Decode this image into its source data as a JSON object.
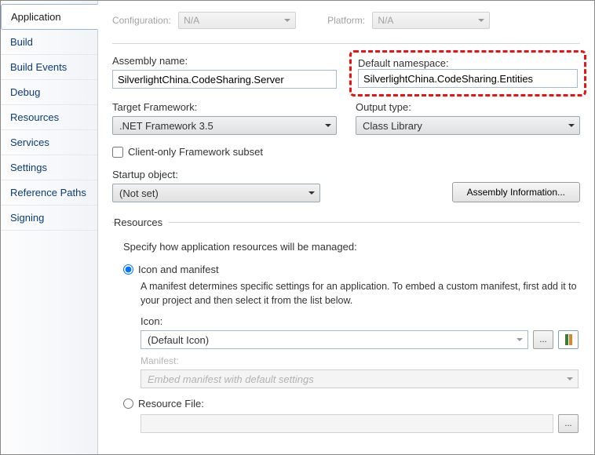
{
  "sidebar": {
    "tabs": [
      {
        "label": "Application"
      },
      {
        "label": "Build"
      },
      {
        "label": "Build Events"
      },
      {
        "label": "Debug"
      },
      {
        "label": "Resources"
      },
      {
        "label": "Services"
      },
      {
        "label": "Settings"
      },
      {
        "label": "Reference Paths"
      },
      {
        "label": "Signing"
      }
    ]
  },
  "top": {
    "config_label": "Configuration:",
    "config_value": "N/A",
    "platform_label": "Platform:",
    "platform_value": "N/A"
  },
  "assembly": {
    "name_label": "Assembly name:",
    "name_value": "SilverlightChina.CodeSharing.Server",
    "namespace_label": "Default namespace:",
    "namespace_value": "SilverlightChina.CodeSharing.Entities"
  },
  "framework": {
    "target_label": "Target Framework:",
    "target_value": ".NET Framework 3.5",
    "output_label": "Output type:",
    "output_value": "Class Library",
    "client_only_label": "Client-only Framework subset"
  },
  "startup": {
    "label": "Startup object:",
    "value": "(Not set)",
    "info_btn": "Assembly Information..."
  },
  "resources": {
    "legend": "Resources",
    "desc": "Specify how application resources will be managed:",
    "icon_manifest_label": "Icon and manifest",
    "icon_manifest_help": "A manifest determines specific settings for an application. To embed a custom manifest, first add it to your project and then select it from the list below.",
    "icon_label": "Icon:",
    "icon_value": "(Default Icon)",
    "manifest_label": "Manifest:",
    "manifest_value": "Embed manifest with default settings",
    "resfile_label": "Resource File:"
  }
}
